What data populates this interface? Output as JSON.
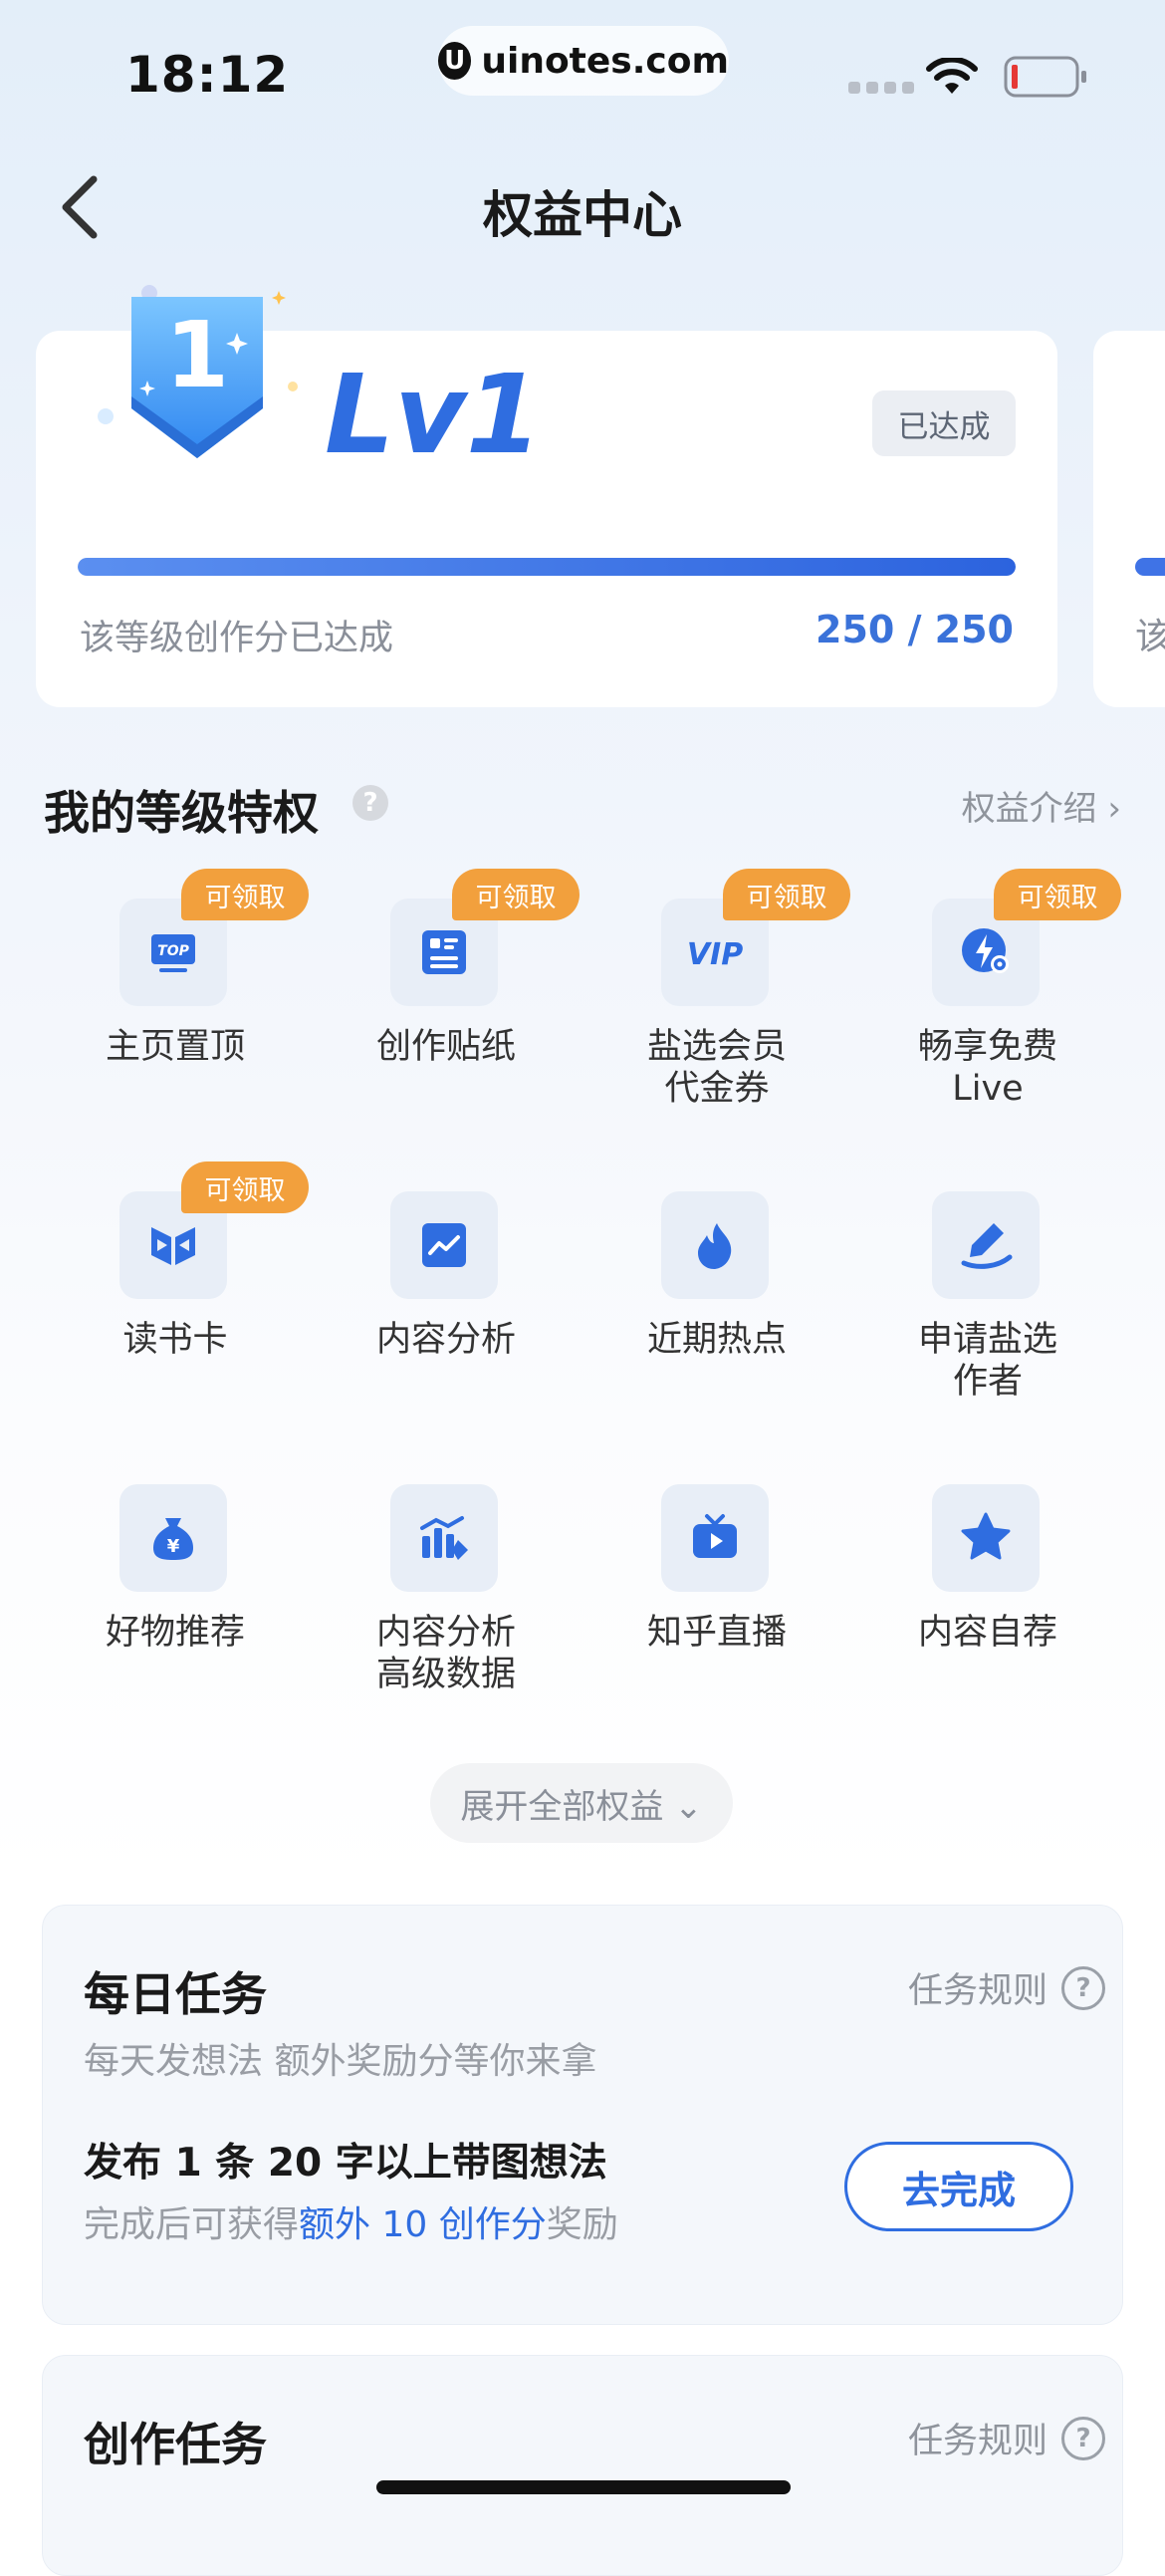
{
  "status_bar": {
    "time": "18:12",
    "url": "uinotes.com",
    "url_logo": "U"
  },
  "nav": {
    "title": "权益中心",
    "back_icon": "chevron-left-icon"
  },
  "level_card": {
    "badge_number": "1",
    "level": "Lv1",
    "status_tag": "已达成",
    "progress": 1.0,
    "caption": "该等级创作分已达成",
    "count": "250 / 250",
    "next_card_caption": "该"
  },
  "privileges": {
    "title": "我的等级特权",
    "help": "?",
    "link": "权益介绍 ›",
    "claim_label": "可领取",
    "items": [
      {
        "label": "主页置顶",
        "icon": "top-icon",
        "claimable": true
      },
      {
        "label": "创作贴纸",
        "icon": "sticker-icon",
        "claimable": true
      },
      {
        "label": "盐选会员\n代金券",
        "icon": "vip-icon",
        "claimable": true
      },
      {
        "label": "畅享免费\nLive",
        "icon": "live-icon",
        "claimable": true
      },
      {
        "label": "读书卡",
        "icon": "book-icon",
        "claimable": true
      },
      {
        "label": "内容分析",
        "icon": "analytics-icon",
        "claimable": false
      },
      {
        "label": "近期热点",
        "icon": "flame-icon",
        "claimable": false
      },
      {
        "label": "申请盐选\n作者",
        "icon": "pen-icon",
        "claimable": false
      },
      {
        "label": "好物推荐",
        "icon": "money-bag-icon",
        "claimable": false
      },
      {
        "label": "内容分析\n高级数据",
        "icon": "advanced-chart-icon",
        "claimable": false
      },
      {
        "label": "知乎直播",
        "icon": "tv-play-icon",
        "claimable": false
      },
      {
        "label": "内容自荐",
        "icon": "star-icon",
        "claimable": false
      }
    ],
    "expand": "展开全部权益 ⌄"
  },
  "daily_task": {
    "title": "每日任务",
    "rules": "任务规则",
    "subtitle": "每天发想法 额外奖励分等你来拿",
    "item_title": "发布 1 条 20 字以上带图想法",
    "desc_prefix": "完成后可获得",
    "desc_highlight": "额外 10 创作分",
    "desc_suffix": "奖励",
    "button": "去完成"
  },
  "creation_task": {
    "title": "创作任务",
    "rules": "任务规则"
  },
  "colors": {
    "accent": "#2f6de0",
    "claim_tag": "#f2a03d",
    "icon_bg": "#e8eef7"
  }
}
